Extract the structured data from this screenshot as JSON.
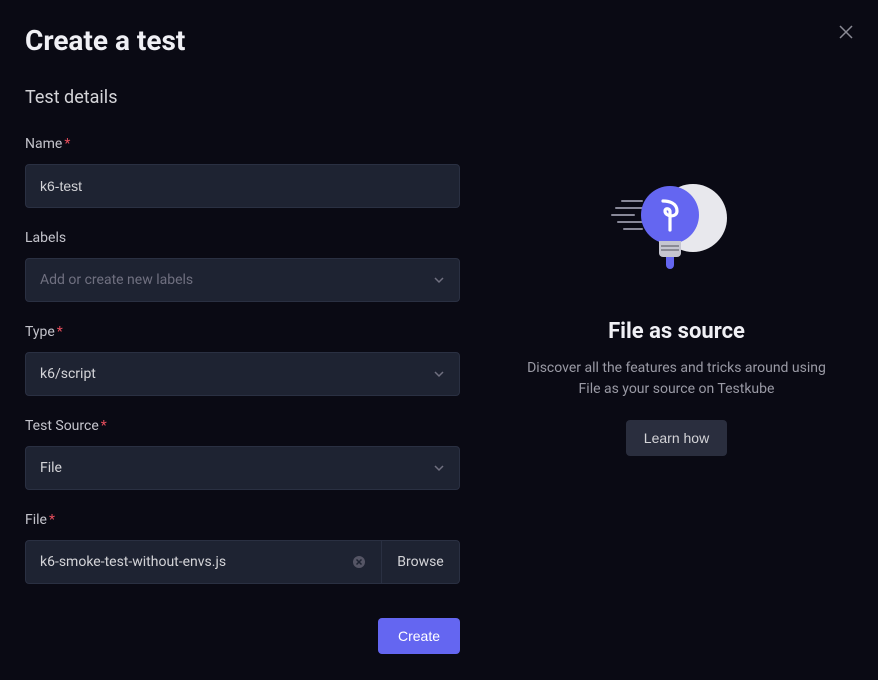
{
  "modal": {
    "title": "Create a test",
    "section_title": "Test details"
  },
  "form": {
    "name": {
      "label": "Name",
      "value": "k6-test"
    },
    "labels": {
      "label": "Labels",
      "placeholder": "Add or create new labels"
    },
    "type": {
      "label": "Type",
      "value": "k6/script"
    },
    "test_source": {
      "label": "Test Source",
      "value": "File"
    },
    "file": {
      "label": "File",
      "value": "k6-smoke-test-without-envs.js",
      "browse_label": "Browse"
    },
    "create_button": "Create"
  },
  "info_panel": {
    "title": "File as source",
    "description": "Discover all the features and tricks around using File as your source on Testkube",
    "learn_button": "Learn how"
  }
}
